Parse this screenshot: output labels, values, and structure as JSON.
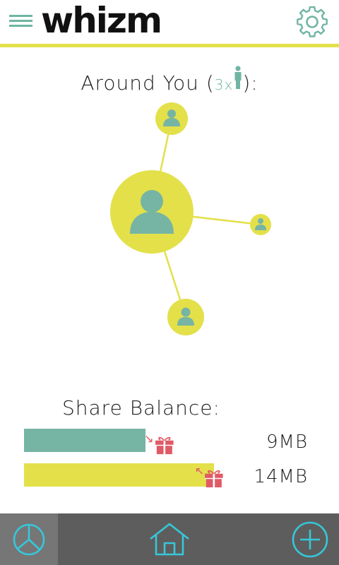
{
  "header": {
    "logo_text": "whizm",
    "menu_icon": "hamburger-menu-icon",
    "settings_icon": "gear-icon"
  },
  "around": {
    "title_prefix": "Around You (",
    "count_text": "3x",
    "title_suffix": "):",
    "person_icon": "person-standing-icon",
    "nearby_users": 3
  },
  "share_balance": {
    "title": "Share Balance:",
    "rows": [
      {
        "value": "9MB",
        "bar_fraction": 0.41,
        "color": "#76b4a4",
        "gift_direction": "incoming"
      },
      {
        "value": "14MB",
        "bar_fraction": 0.64,
        "color": "#e3e04a",
        "gift_direction": "outgoing"
      }
    ]
  },
  "bottom_nav": {
    "items": [
      {
        "icon": "pie-chart-icon",
        "active": true
      },
      {
        "icon": "home-icon",
        "active": false
      },
      {
        "icon": "plus-circle-icon",
        "active": false
      }
    ]
  },
  "colors": {
    "accent_yellow": "#e3e04a",
    "accent_teal": "#76b4a4",
    "gift_red": "#e05a66",
    "nav_bg": "#5d5d5d",
    "nav_active_bg": "#767676",
    "nav_icon": "#36c7d9"
  }
}
